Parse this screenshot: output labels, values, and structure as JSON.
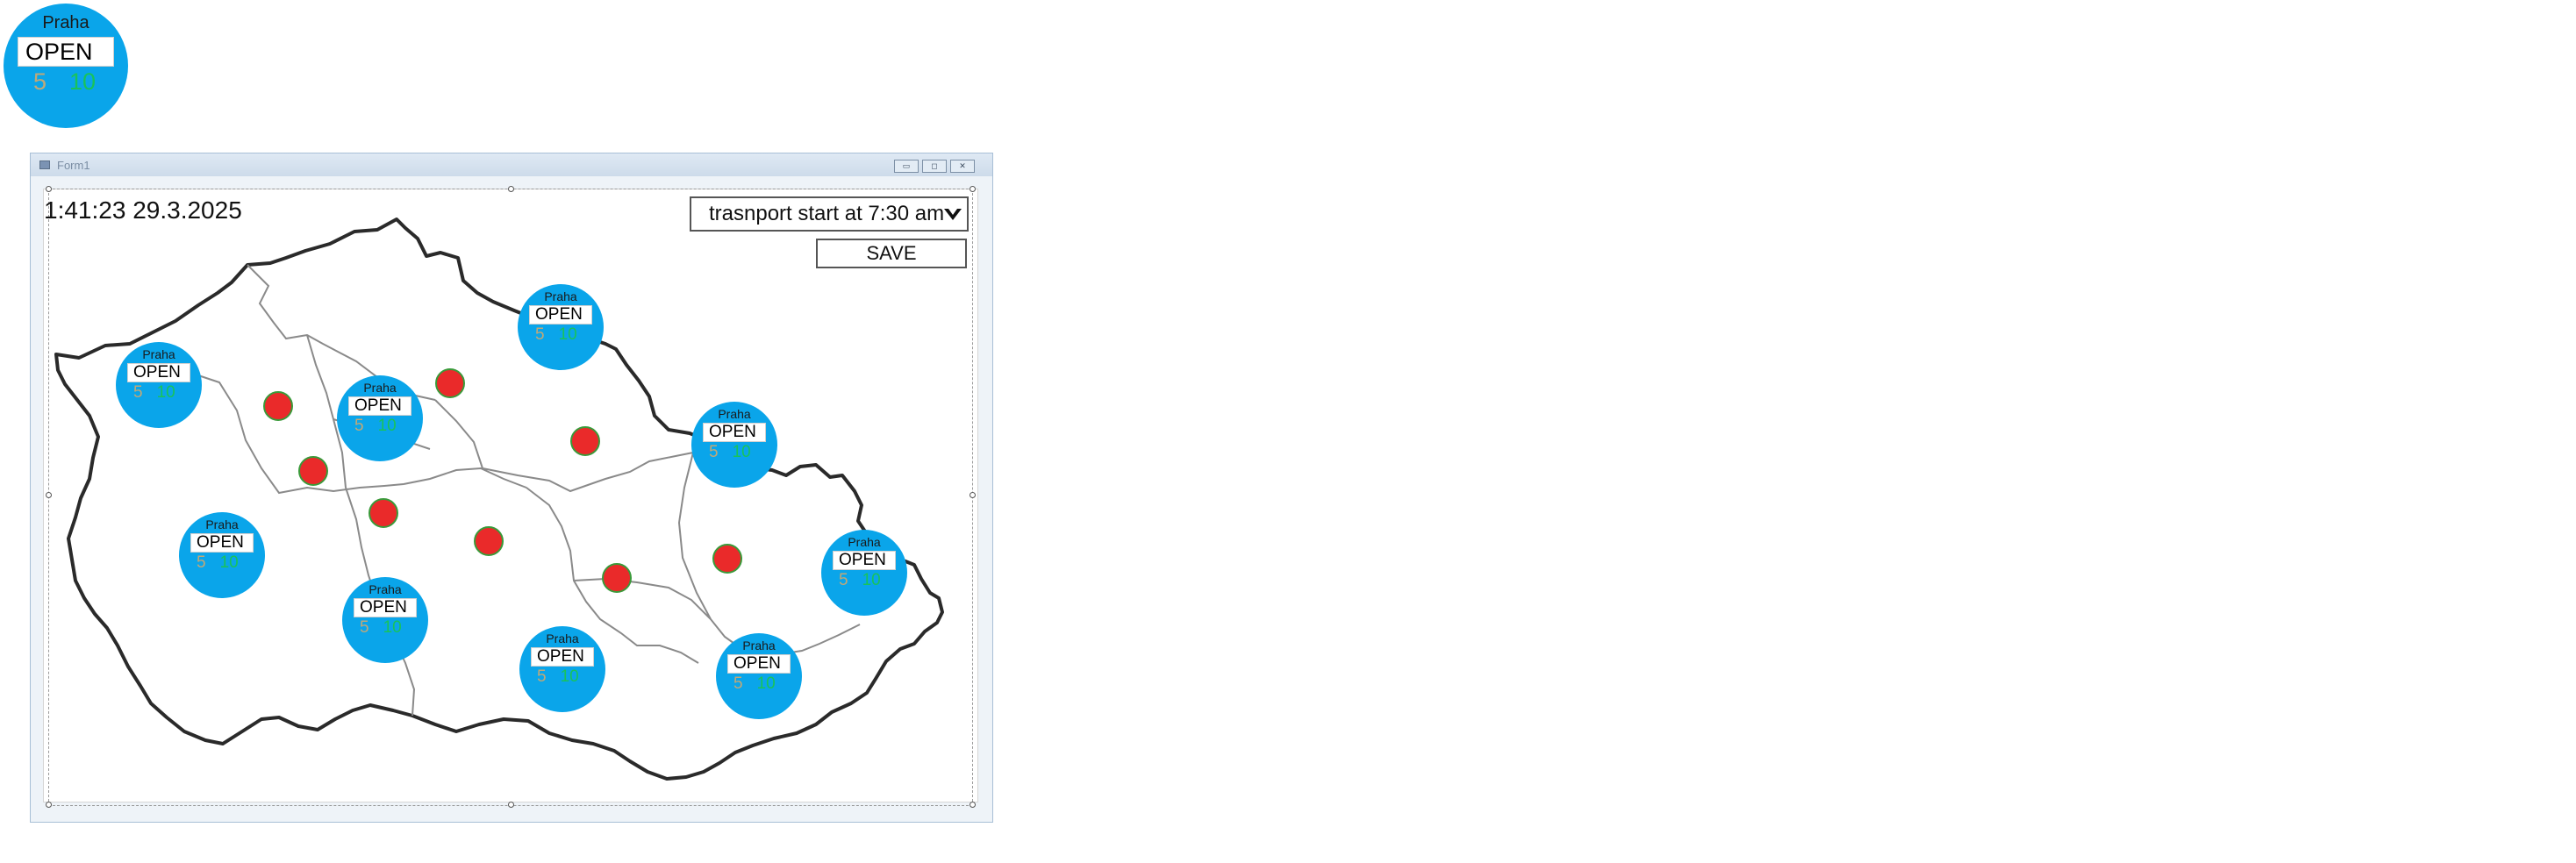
{
  "station_template": {
    "city": "Praha",
    "status": "OPEN",
    "count_a": "5",
    "count_b": "10"
  },
  "window": {
    "title": "Form1",
    "minimize_glyph": "▭",
    "maximize_glyph": "◻",
    "close_glyph": "✕"
  },
  "clock": "1:41:23 29.3.2025",
  "transport_select": {
    "value": "trasnport start at 7:30 am"
  },
  "save_label": "SAVE",
  "map_stations": [
    {
      "city": "Praha",
      "status": "OPEN",
      "count_a": "5",
      "count_b": "10"
    },
    {
      "city": "Praha",
      "status": "OPEN",
      "count_a": "5",
      "count_b": "10"
    },
    {
      "city": "Praha",
      "status": "OPEN",
      "count_a": "5",
      "count_b": "10"
    },
    {
      "city": "Praha",
      "status": "OPEN",
      "count_a": "5",
      "count_b": "10"
    },
    {
      "city": "Praha",
      "status": "OPEN",
      "count_a": "5",
      "count_b": "10"
    },
    {
      "city": "Praha",
      "status": "OPEN",
      "count_a": "5",
      "count_b": "10"
    },
    {
      "city": "Praha",
      "status": "OPEN",
      "count_a": "5",
      "count_b": "10"
    },
    {
      "city": "Praha",
      "status": "OPEN",
      "count_a": "5",
      "count_b": "10"
    },
    {
      "city": "Praha",
      "status": "OPEN",
      "count_a": "5",
      "count_b": "10"
    }
  ],
  "colors": {
    "station_fill": "#0aa5ea",
    "marker_fill": "#ea2a2a",
    "marker_border": "#3a9a3a",
    "count_a": "#c0a878",
    "count_b": "#19c35a"
  }
}
